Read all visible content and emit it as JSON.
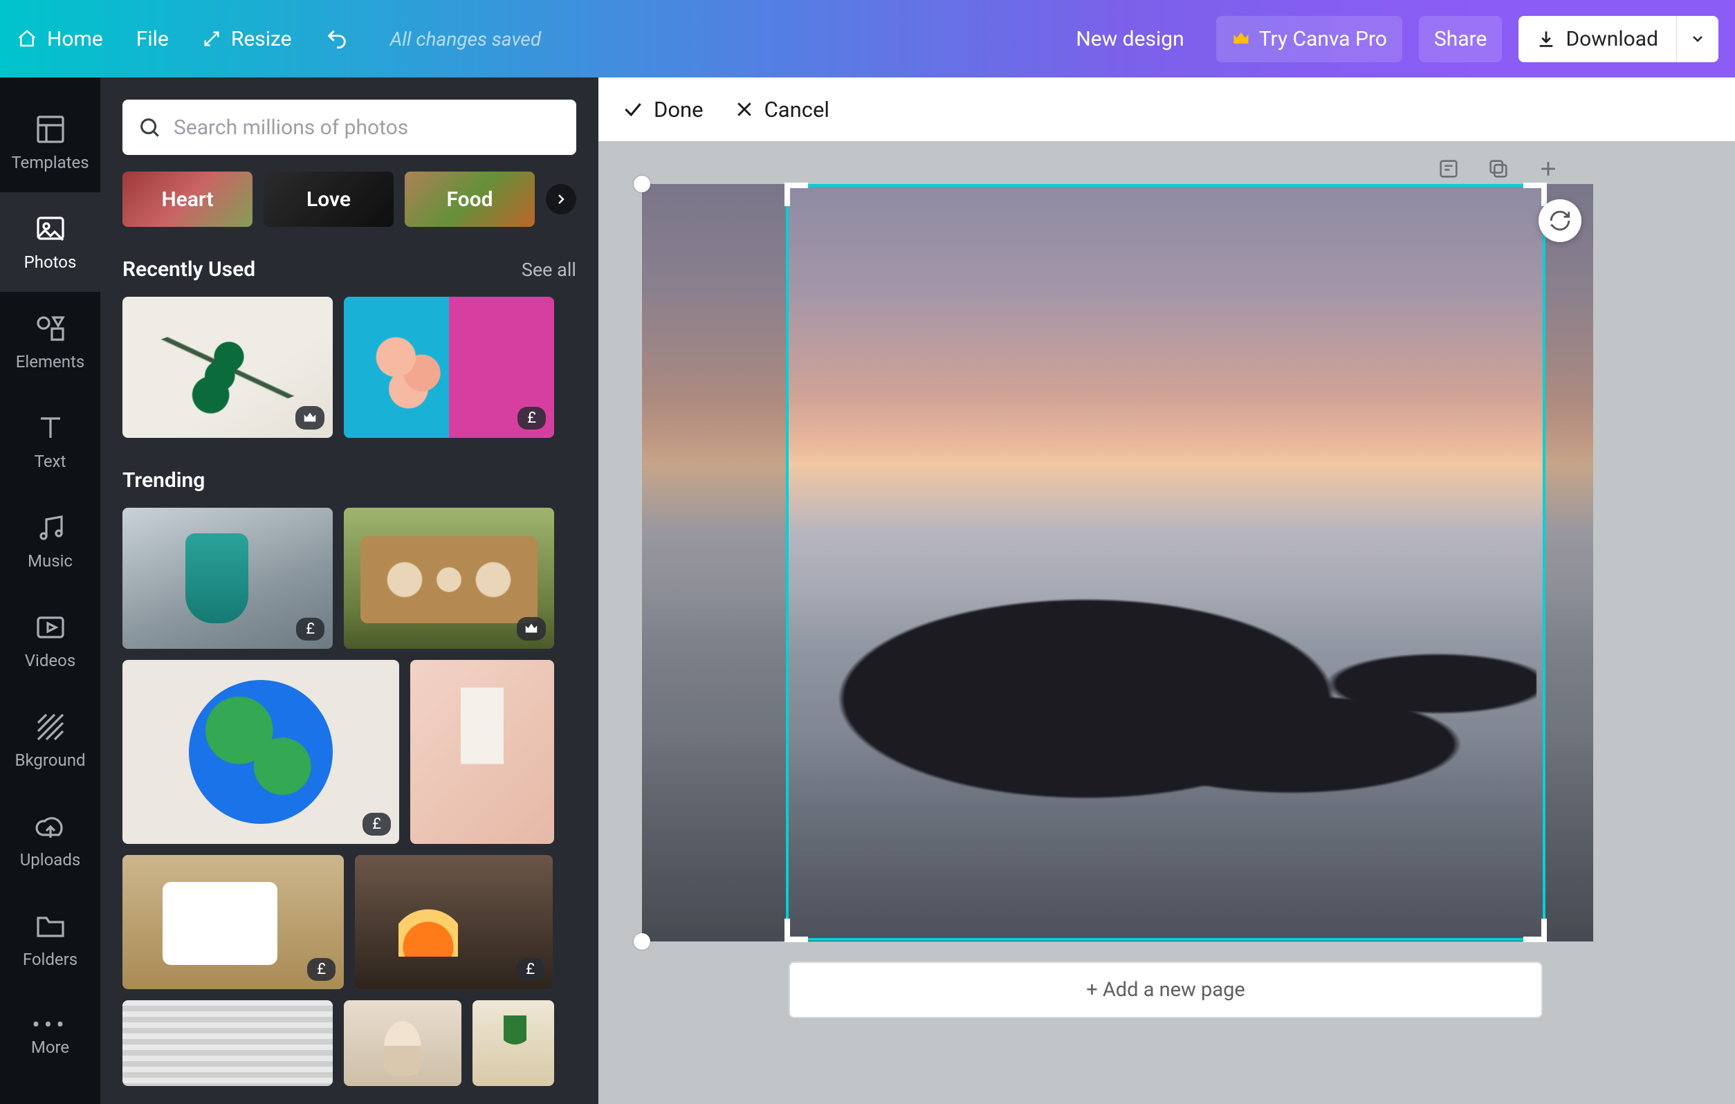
{
  "topbar": {
    "home": "Home",
    "file": "File",
    "resize": "Resize",
    "save_state": "All changes saved",
    "new_design": "New design",
    "try_pro": "Try Canva Pro",
    "share": "Share",
    "download": "Download"
  },
  "rail": {
    "templates": "Templates",
    "photos": "Photos",
    "elements": "Elements",
    "text": "Text",
    "music": "Music",
    "videos": "Videos",
    "background": "Bkground",
    "uploads": "Uploads",
    "folders": "Folders",
    "more": "More"
  },
  "sidebar": {
    "search_placeholder": "Search millions of photos",
    "categories": {
      "c0": "Heart",
      "c1": "Love",
      "c2": "Food"
    },
    "sections": {
      "recent": {
        "title": "Recently Used",
        "see_all": "See all"
      },
      "trending": {
        "title": "Trending"
      }
    },
    "price_badge": "£"
  },
  "crop_toolbar": {
    "done": "Done",
    "cancel": "Cancel"
  },
  "canvas": {
    "add_page": "+ Add a new page"
  }
}
